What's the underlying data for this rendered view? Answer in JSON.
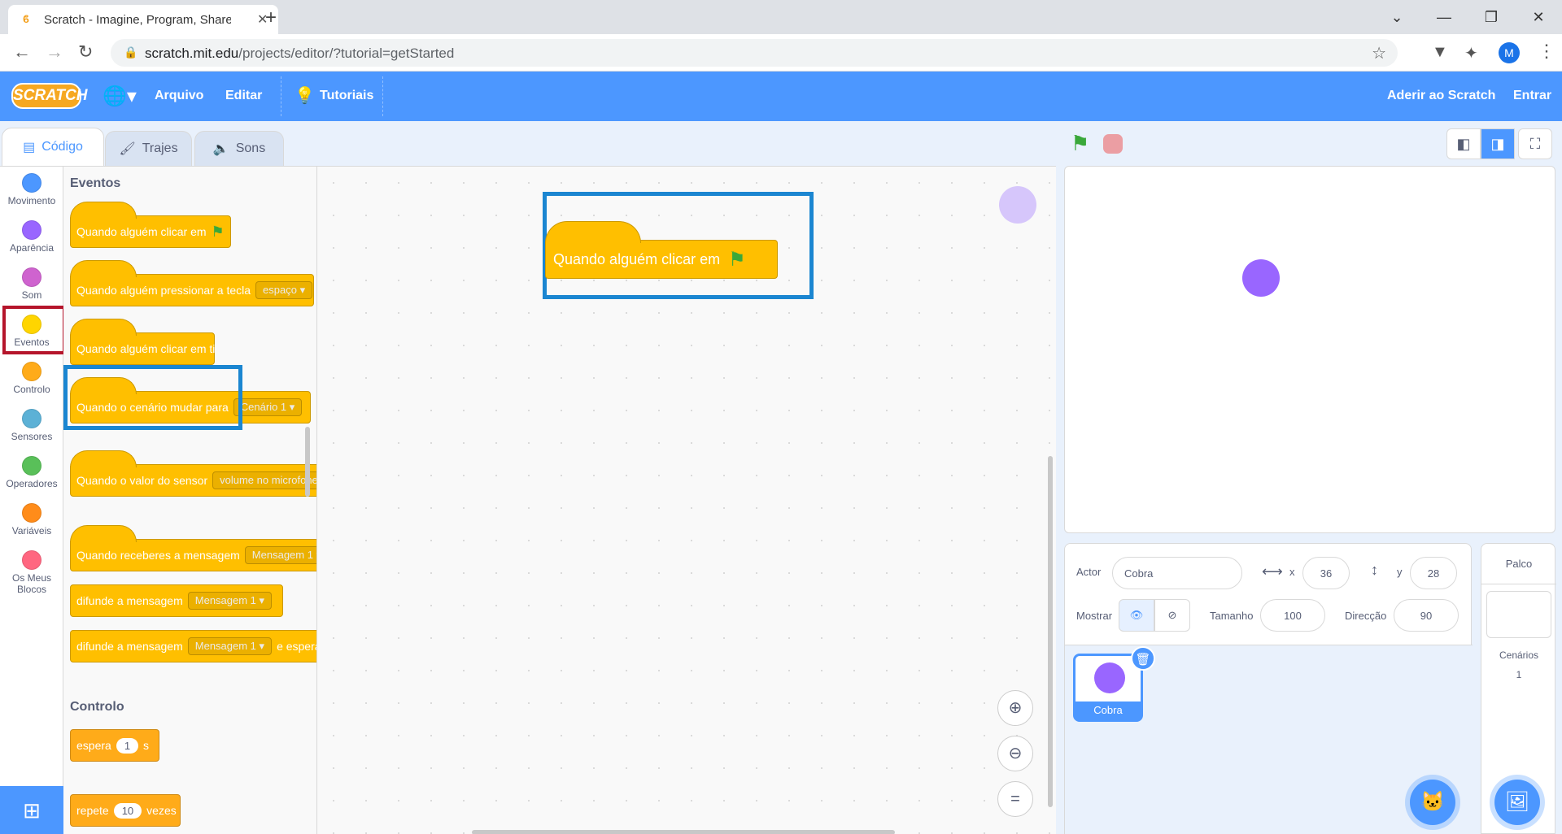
{
  "browser": {
    "tab_title": "Scratch - Imagine, Program, Share",
    "url_host": "scratch.mit.edu",
    "url_path": "/projects/editor/?tutorial=getStarted",
    "profile_initial": "M"
  },
  "menubar": {
    "logo": "SCRATCH",
    "file": "Arquivo",
    "edit": "Editar",
    "tutorials": "Tutoriais",
    "join": "Aderir ao Scratch",
    "signin": "Entrar"
  },
  "tabs": {
    "code": "Código",
    "costumes": "Trajes",
    "sounds": "Sons"
  },
  "categories": [
    {
      "label": "Movimento",
      "color": "#4c97ff"
    },
    {
      "label": "Aparência",
      "color": "#9966ff"
    },
    {
      "label": "Som",
      "color": "#cf63cf"
    },
    {
      "label": "Eventos",
      "color": "#ffd500"
    },
    {
      "label": "Controlo",
      "color": "#ffab19"
    },
    {
      "label": "Sensores",
      "color": "#5cb1d6"
    },
    {
      "label": "Operadores",
      "color": "#59c059"
    },
    {
      "label": "Variáveis",
      "color": "#ff8c1a"
    },
    {
      "label": "Os Meus Blocos",
      "color": "#ff6680"
    }
  ],
  "palette": {
    "events_title": "Eventos",
    "when_flag": "Quando alguém clicar em",
    "when_key": "Quando alguém pressionar a tecla",
    "key_option": "espaço",
    "when_sprite_clicked": "Quando alguém clicar em ti",
    "when_backdrop": "Quando o cenário mudar para",
    "backdrop_option": "Cenário 1",
    "when_sensor": "Quando o valor do sensor",
    "sensor_option": "volume no microfone",
    "sensor_gt": ">",
    "when_receive": "Quando receberes a mensagem",
    "message_option": "Mensagem 1",
    "broadcast": "difunde a mensagem",
    "broadcast_wait_suffix": "e espera",
    "control_title": "Controlo",
    "wait": "espera",
    "wait_value": "1",
    "wait_unit": "s",
    "repeat": "repete",
    "repeat_value": "10",
    "repeat_unit": "vezes"
  },
  "script": {
    "block_label": "Quando alguém clicar em"
  },
  "sprite_info": {
    "sprite_label": "Actor",
    "sprite_name": "Cobra",
    "x_label": "x",
    "x_value": "36",
    "y_label": "y",
    "y_value": "28",
    "show_label": "Mostrar",
    "size_label": "Tamanho",
    "size_value": "100",
    "direction_label": "Direcção",
    "direction_value": "90"
  },
  "sprite_tile": {
    "name": "Cobra"
  },
  "stage_pane": {
    "title": "Palco",
    "backdrops_label": "Cenários",
    "backdrops_count": "1"
  },
  "highlight_color": "#1b86d1",
  "selected_category_border": "#b5152b"
}
